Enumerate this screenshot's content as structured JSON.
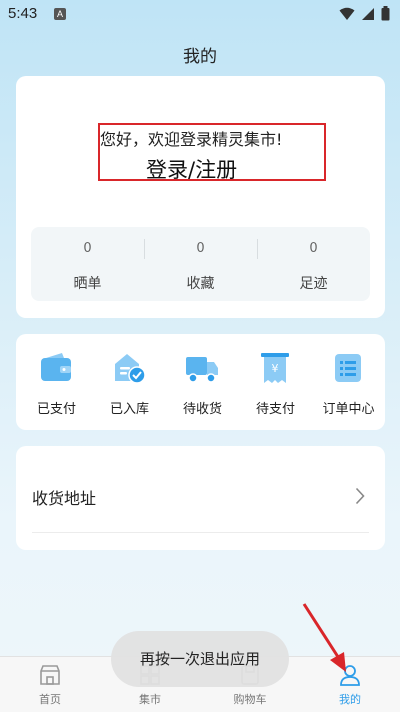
{
  "status_bar": {
    "time": "5:43",
    "notification_badge": "A"
  },
  "page_title": "我的",
  "profile": {
    "welcome": "您好，欢迎登录精灵集市!",
    "login": "登录/注册"
  },
  "stats": [
    {
      "value": "0",
      "label": "晒单"
    },
    {
      "value": "0",
      "label": "收藏"
    },
    {
      "value": "0",
      "label": "足迹"
    }
  ],
  "orders": [
    {
      "label": "已支付",
      "icon": "wallet-icon"
    },
    {
      "label": "已入库",
      "icon": "stocked-icon"
    },
    {
      "label": "待收货",
      "icon": "truck-icon"
    },
    {
      "label": "待支付",
      "icon": "receipt-icon"
    },
    {
      "label": "订单中心",
      "icon": "order-list-icon"
    }
  ],
  "address": {
    "label": "收货地址"
  },
  "toast": "再按一次退出应用",
  "tabs": [
    {
      "label": "首页",
      "icon": "home-icon"
    },
    {
      "label": "集市",
      "icon": "market-icon"
    },
    {
      "label": "购物车",
      "icon": "cart-icon"
    },
    {
      "label": "我的",
      "icon": "user-icon"
    }
  ],
  "colors": {
    "accent": "#2e9de9",
    "annotation": "#d9262a",
    "icon_blue": "#5ab4ef"
  }
}
